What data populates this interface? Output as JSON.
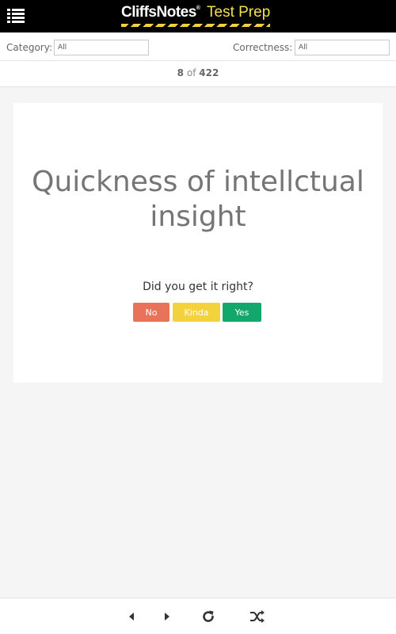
{
  "header": {
    "brand": "CliffsNotes",
    "brand_mark": "®",
    "product": "Test Prep",
    "menu_icon": "list-menu-icon"
  },
  "filters": {
    "category_label": "Category:",
    "category_value": "All",
    "correctness_label": "Correctness:",
    "correctness_value": "All"
  },
  "counter": {
    "current": "8",
    "separator": "of",
    "total": "422"
  },
  "card": {
    "term": "Quickness of intellctual insight",
    "prompt": "Did you get it right?",
    "buttons": {
      "no": "No",
      "kinda": "Kinda",
      "yes": "Yes"
    }
  },
  "colors": {
    "no": "#e8735a",
    "kinda": "#f3d23b",
    "yes": "#12a86b",
    "logo_accent": "#f4e04d"
  },
  "footer": {
    "icons": [
      "previous-icon",
      "next-icon",
      "restart-icon",
      "shuffle-icon"
    ]
  }
}
